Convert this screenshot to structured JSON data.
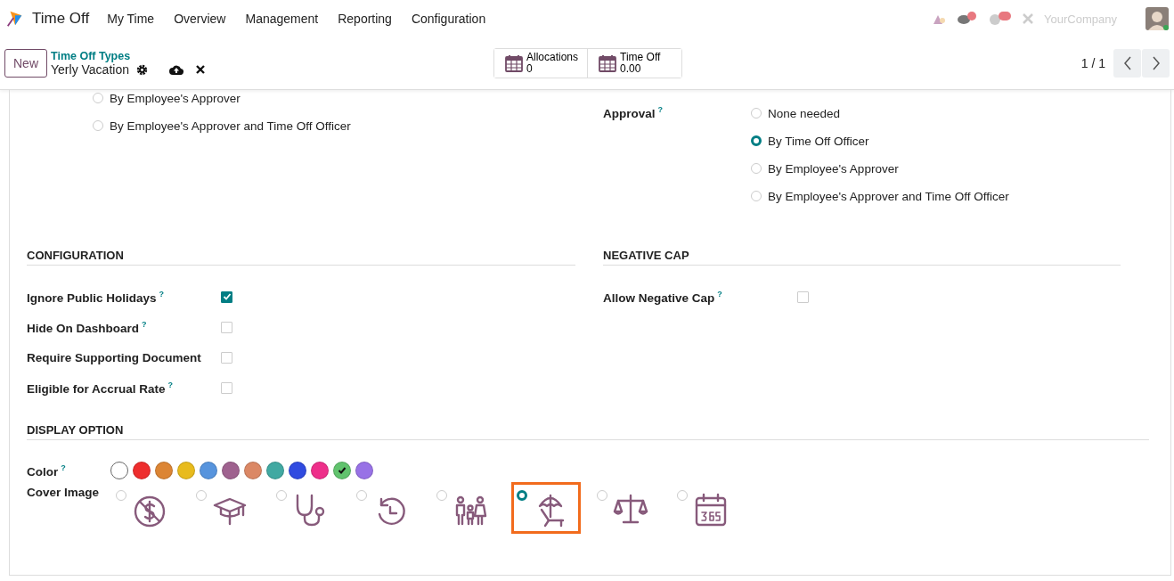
{
  "app": {
    "name": "Time Off"
  },
  "menu": [
    "My Time",
    "Overview",
    "Management",
    "Reporting",
    "Configuration"
  ],
  "systray": {
    "company": "YourCompany"
  },
  "control_panel": {
    "new_button": "New",
    "breadcrumb": "Time Off Types",
    "record": "Yerly Vacation",
    "pager": "1 / 1",
    "smart_buttons": [
      {
        "label": "Allocations",
        "value": "0"
      },
      {
        "label": "Time Off",
        "value": "0.00"
      }
    ]
  },
  "left_options": [
    {
      "label": "By Employee's Approver",
      "selected": false
    },
    {
      "label": "By Employee's Approver and Time Off Officer",
      "selected": false
    }
  ],
  "approval": {
    "label": "Approval",
    "help": "?",
    "options": [
      {
        "label": "None needed",
        "selected": false
      },
      {
        "label": "By Time Off Officer",
        "selected": true
      },
      {
        "label": "By Employee's Approver",
        "selected": false
      },
      {
        "label": "By Employee's Approver and Time Off Officer",
        "selected": false
      }
    ]
  },
  "configuration": {
    "title": "CONFIGURATION",
    "fields": [
      {
        "label": "Ignore Public Holidays",
        "help": "?",
        "checked": true
      },
      {
        "label": "Hide On Dashboard",
        "help": "?",
        "checked": false
      },
      {
        "label": "Require Supporting Document",
        "checked": false
      },
      {
        "label": "Eligible for Accrual Rate",
        "help": "?",
        "checked": false
      }
    ]
  },
  "negative_cap": {
    "title": "NEGATIVE CAP",
    "fields": [
      {
        "label": "Allow Negative Cap",
        "help": "?",
        "checked": false
      }
    ]
  },
  "display_option": {
    "title": "DISPLAY OPTION",
    "color": {
      "label": "Color",
      "help": "?",
      "swatches": [
        {
          "color": "#ffffff",
          "selected": false
        },
        {
          "color": "#ee2d2d",
          "selected": false
        },
        {
          "color": "#dc8534",
          "selected": false
        },
        {
          "color": "#e8bb1d",
          "selected": false
        },
        {
          "color": "#5794dd",
          "selected": false
        },
        {
          "color": "#9f628f",
          "selected": false
        },
        {
          "color": "#db8865",
          "selected": false
        },
        {
          "color": "#41a9a2",
          "selected": false
        },
        {
          "color": "#304be0",
          "selected": false
        },
        {
          "color": "#ee2f8a",
          "selected": false
        },
        {
          "color": "#61c36e",
          "selected": true
        },
        {
          "color": "#9872e6",
          "selected": false
        }
      ]
    },
    "cover_image": {
      "label": "Cover Image",
      "options": [
        {
          "kind": "no-money",
          "selected": false
        },
        {
          "kind": "graduation",
          "selected": false
        },
        {
          "kind": "stethoscope",
          "selected": false
        },
        {
          "kind": "history",
          "selected": false
        },
        {
          "kind": "family",
          "selected": false
        },
        {
          "kind": "beach",
          "selected": true
        },
        {
          "kind": "scales",
          "selected": false
        },
        {
          "kind": "calendar",
          "selected": false
        }
      ]
    }
  }
}
